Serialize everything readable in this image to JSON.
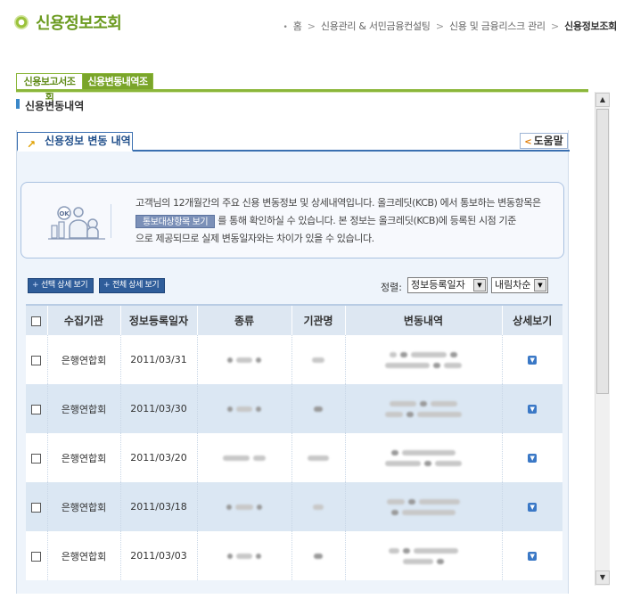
{
  "header": {
    "title": "신용정보조회",
    "breadcrumb": {
      "home": "홈",
      "items": [
        "신용관리 & 서민금융컨설팅",
        "신용 및 금융리스크 관리"
      ],
      "current": "신용정보조회"
    }
  },
  "tabs": [
    {
      "label": "신용보고서조회",
      "active": false
    },
    {
      "label": "신용변동내역조회",
      "active": true
    }
  ],
  "section": {
    "title": "신용변동내역"
  },
  "panel": {
    "tab_label": "신용정보 변동 내역",
    "help_label": "도움말",
    "info": {
      "line1": "고객님의 12개월간의 주요 신용 변동정보 및 상세내역입니다. 올크레딧(KCB) 에서 통보하는 변동항목은",
      "button_label": "통보대상항목 보기",
      "line2_after_button": " 를 통해 확인하실 수 있습니다. 본 정보는 올크레딧(KCB)에  등록된 시점 기준",
      "line3": "으로 제공되므로 실제 변동일자와는 차이가 있을 수 있습니다."
    },
    "controls": {
      "select_detail_label": "선택 상세 보기",
      "all_detail_label": "전체 상세 보기",
      "sort_label": "정렬:",
      "sort_field": "정보등록일자",
      "sort_order": "내림차순"
    },
    "table": {
      "columns": [
        "수집기관",
        "정보등록일자",
        "종류",
        "기관명",
        "변동내역",
        "상세보기"
      ],
      "rows": [
        {
          "agency": "은행연합회",
          "date": "2011/03/31"
        },
        {
          "agency": "은행연합회",
          "date": "2011/03/30"
        },
        {
          "agency": "은행연합회",
          "date": "2011/03/20"
        },
        {
          "agency": "은행연합회",
          "date": "2011/03/18"
        },
        {
          "agency": "은행연합회",
          "date": "2011/03/03"
        }
      ]
    }
  },
  "colors": {
    "brand_green": "#6a9a1e",
    "tab_green": "#7aa52a",
    "panel_blue": "#3a6fb0",
    "row_stripe": "#dbe7f3"
  }
}
